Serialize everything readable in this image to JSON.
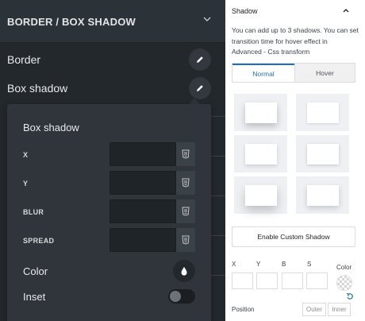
{
  "left_panel": {
    "section_title": "BORDER / BOX SHADOW",
    "rows": [
      {
        "label": "Border"
      },
      {
        "label": "Box shadow"
      }
    ]
  },
  "popover": {
    "title": "Box shadow",
    "fields": [
      {
        "label": "X",
        "value": ""
      },
      {
        "label": "Y",
        "value": ""
      },
      {
        "label": "BLUR",
        "value": ""
      },
      {
        "label": "SPREAD",
        "value": ""
      }
    ],
    "color_label": "Color",
    "inset_label": "Inset",
    "inset_on": false
  },
  "right_panel": {
    "heading": "Shadow",
    "description": "You can add up to 3 shadows. You can set transition time for hover effect in Advanced - Css transform",
    "tabs": [
      {
        "label": "Normal",
        "active": true
      },
      {
        "label": "Hover",
        "active": false
      }
    ],
    "enable_button": "Enable Custom Shadow",
    "shadow_fields": {
      "x": "X",
      "y": "Y",
      "b": "B",
      "s": "S",
      "color": "Color"
    },
    "position_label": "Position",
    "position_options": [
      "Outer",
      "Inner"
    ]
  },
  "colors": {
    "dark_bg": "#23282d",
    "popover_bg": "#2f353a",
    "accent": "#2271b1"
  }
}
